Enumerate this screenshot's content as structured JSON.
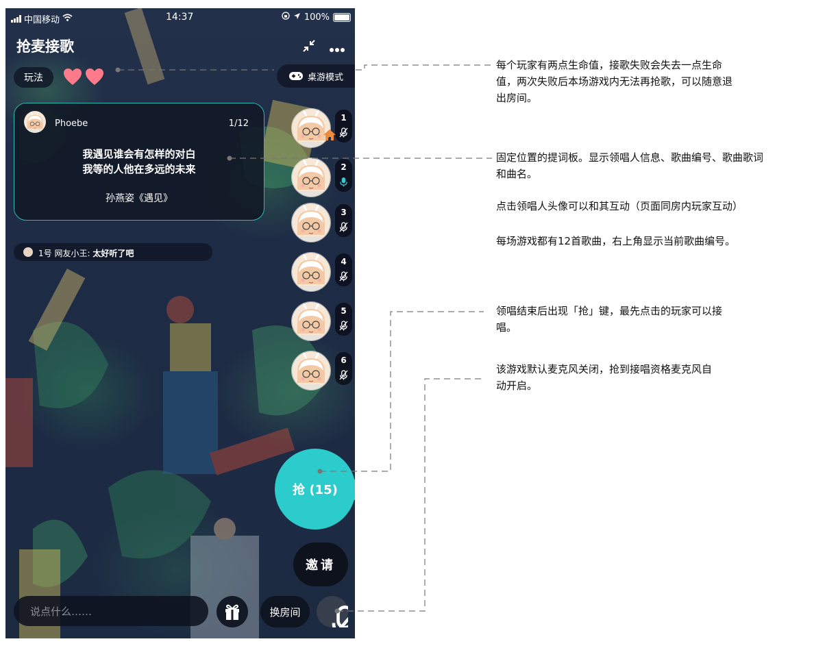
{
  "status_bar": {
    "carrier": "中国移动",
    "time": "14:37",
    "battery": "100%"
  },
  "header": {
    "title": "抢麦接歌",
    "collapse_icon": "collapse-arrows-icon",
    "more_icon": "more-dots-icon"
  },
  "toolbar": {
    "rules_label": "玩法",
    "lives": 2,
    "mode_label": "桌游模式",
    "mode_icon": "gamepad-icon"
  },
  "lyric_board": {
    "singer_name": "Phoebe",
    "song_counter": "1/12",
    "lyric_lines": [
      "我遇见谁会有怎样的对白",
      "我等的人他在多远的未来"
    ],
    "song_title": "孙燕姿《遇见》"
  },
  "chat": {
    "sender": "1号 网友小王:",
    "message": "太好听了吧"
  },
  "seats": [
    {
      "number": "1",
      "mic": "muted",
      "host": true
    },
    {
      "number": "2",
      "mic": "on",
      "host": false
    },
    {
      "number": "3",
      "mic": "muted",
      "host": false
    },
    {
      "number": "4",
      "mic": "muted",
      "host": false
    },
    {
      "number": "5",
      "mic": "muted",
      "host": false
    },
    {
      "number": "6",
      "mic": "muted",
      "host": false
    }
  ],
  "grab_button": {
    "label": "抢 (15)"
  },
  "invite_button": {
    "label": "邀请"
  },
  "input": {
    "placeholder": "说点什么……"
  },
  "gift_icon": "gift-icon",
  "change_room_button": {
    "label": "换房间"
  },
  "mic_button_icon": "mic-muted-icon",
  "colors": {
    "accent": "#2ccccc",
    "heart": "#ff7b8c",
    "mic_on": "#2ccccc",
    "host_badge": "#f08a3c"
  },
  "annotations": {
    "lives": [
      "每个玩家有两点生命值，接歌失败会失去一点生命",
      "值，两次失败后本场游戏内无法再抢歌，可以随意退",
      "出房间。"
    ],
    "board_1": [
      "固定位置的提词板。显示领唱人信息、歌曲编号、歌曲歌词",
      "和曲名。"
    ],
    "board_2": "点击领唱人头像可以和其互动（页面同房内玩家互动）",
    "board_3": "每场游戏都有12首歌曲，右上角显示当前歌曲编号。",
    "grab": [
      "领唱结束后出现「抢」键，最先点击的玩家可以接",
      "唱。"
    ],
    "mic": [
      "该游戏默认麦克风关闭，抢到接唱资格麦克风自",
      "动开启。"
    ]
  }
}
